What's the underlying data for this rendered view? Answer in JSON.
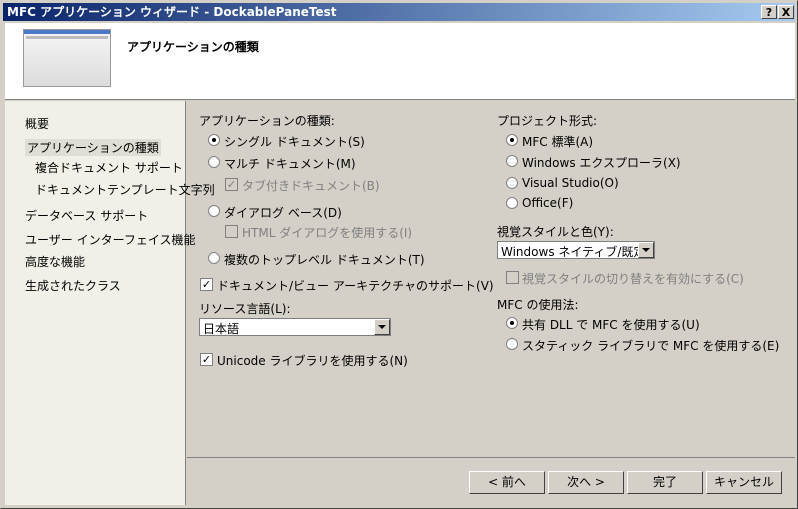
{
  "window": {
    "title": "MFC アプリケーション ウィザード - DockablePaneTest",
    "help_label": "?",
    "close_label": "X"
  },
  "header": {
    "title": "アプリケーションの種類"
  },
  "sidebar": {
    "items": [
      {
        "label": "概要"
      },
      {
        "label": "アプリケーションの種類"
      },
      {
        "label": "複合ドキュメント サポート"
      },
      {
        "label": "ドキュメントテンプレート文字列"
      },
      {
        "label": "データベース サポート"
      },
      {
        "label": "ユーザー インターフェイス機能"
      },
      {
        "label": "高度な機能"
      },
      {
        "label": "生成されたクラス"
      }
    ]
  },
  "left": {
    "app_type_label": "アプリケーションの種類:",
    "single_doc": "シングル ドキュメント(S)",
    "multi_doc": "マルチ ドキュメント(M)",
    "tabbed_doc": "タブ付きドキュメント(B)",
    "dialog_based": "ダイアログ ベース(D)",
    "html_dialog": "HTML ダイアログを使用する(I)",
    "multi_toplevel": "複数のトップレベル ドキュメント(T)",
    "docview": "ドキュメント/ビュー アーキテクチャのサポート(V)",
    "resource_lang_label": "リソース言語(L):",
    "resource_lang_value": "日本語",
    "unicode": "Unicode ライブラリを使用する(N)"
  },
  "right": {
    "project_style_label": "プロジェクト形式:",
    "mfc_standard": "MFC 標準(A)",
    "explorer": "Windows エクスプローラ(X)",
    "visual_studio": "Visual Studio(O)",
    "office": "Office(F)",
    "visual_style_label": "視覚スタイルと色(Y):",
    "visual_style_value": "Windows ネイティブ/既定",
    "style_switch": "視覚スタイルの切り替えを有効にする(C)",
    "mfc_use_label": "MFC の使用法:",
    "shared_dll": "共有 DLL で MFC を使用する(U)",
    "static_lib": "スタティック ライブラリで MFC を使用する(E)"
  },
  "footer": {
    "back": "< 前へ",
    "next": "次へ >",
    "finish": "完了",
    "cancel": "キャンセル"
  }
}
